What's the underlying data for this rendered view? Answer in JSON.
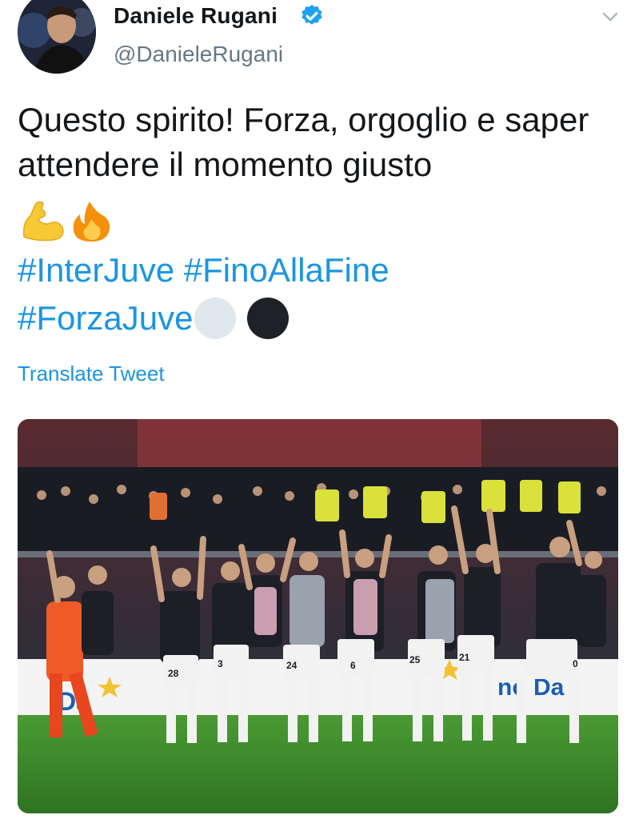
{
  "user": {
    "display_name": "Daniele Rugani",
    "handle": "@DanieleRugani",
    "verified_icon": "verified-badge-icon",
    "avatar_icon": "avatar"
  },
  "menu": {
    "icon": "chevron-down-icon"
  },
  "tweet": {
    "text": "Questo spirito! Forza, orgoglio e saper attendere il momento giusto",
    "emojis": [
      "flexed-biceps-icon",
      "fire-icon"
    ],
    "hashtags": [
      "#InterJuve",
      "#FinoAllaFine",
      "#ForzaJuve"
    ],
    "trailing_emojis": [
      "white-circle-icon",
      "black-circle-icon"
    ]
  },
  "translate_label": "Translate Tweet",
  "media": {
    "description_icon": "team-photo",
    "jersey_numbers": [
      "24",
      "28",
      "3",
      "24",
      "6",
      "25",
      "21",
      "0"
    ],
    "colors": {
      "pitch": "#3f8a2c",
      "stands": "#8a3a3a",
      "accent": "#1b95e0",
      "keeper": "#f05a28"
    }
  }
}
